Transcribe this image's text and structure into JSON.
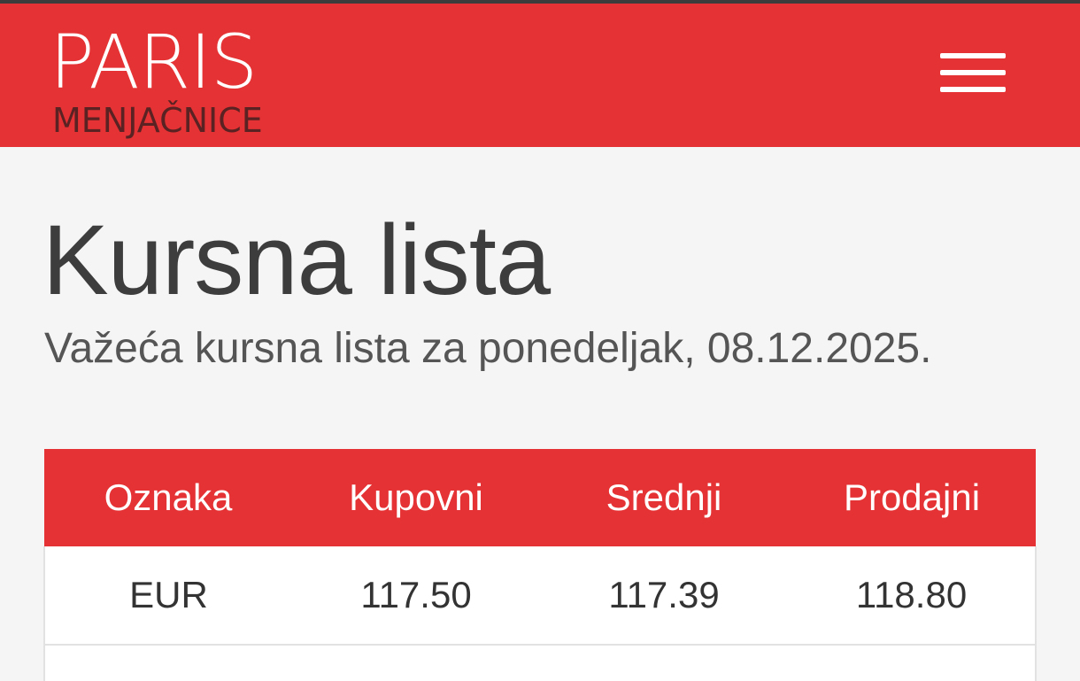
{
  "brand": {
    "name": "PARIS",
    "tagline": "MENJAČNICE"
  },
  "header": {
    "menu_icon": "hamburger-menu-icon",
    "background_color": "#e53234"
  },
  "main": {
    "title": "Kursna lista",
    "subtitle": "Važeća kursna lista za ponedeljak, 08.12.2025."
  },
  "table": {
    "headers": [
      "Oznaka",
      "Kupovni",
      "Srednji",
      "Prodajni"
    ],
    "rows": [
      {
        "code": "EUR",
        "buy": "117.50",
        "mid": "117.39",
        "sell": "118.80"
      }
    ]
  }
}
